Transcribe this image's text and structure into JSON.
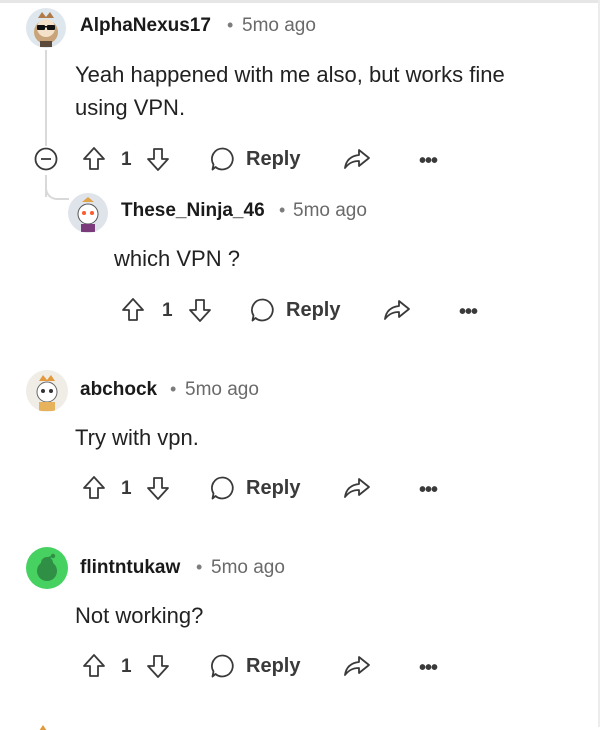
{
  "comments": [
    {
      "username": "AlphaNexus17",
      "time": "5mo ago",
      "body_lines": [
        "Yeah happened with me also, but works fine",
        "using VPN."
      ],
      "votes": "1",
      "reply_label": "Reply"
    },
    {
      "username": "These_Ninja_46",
      "time": "5mo ago",
      "body_lines": [
        "which VPN ?"
      ],
      "votes": "1",
      "reply_label": "Reply"
    },
    {
      "username": "abchock",
      "time": "5mo ago",
      "body_lines": [
        "Try with vpn."
      ],
      "votes": "1",
      "reply_label": "Reply"
    },
    {
      "username": "flintntukaw",
      "time": "5mo ago",
      "body_lines": [
        "Not working?"
      ],
      "votes": "1",
      "reply_label": "Reply"
    }
  ],
  "separator": "•",
  "more_label": "•••",
  "icons": {
    "collapse": "collapse-icon",
    "upvote": "upvote-arrow-icon",
    "downvote": "downvote-arrow-icon",
    "reply": "reply-bubble-icon",
    "share": "share-arrow-icon",
    "more": "more-options-icon"
  },
  "colors": {
    "text": "#1a1a1b",
    "meta": "#6a6a6a",
    "action": "#3a3a3a",
    "thread_line": "#d9d9d9",
    "avatar_green": "#46d160"
  }
}
